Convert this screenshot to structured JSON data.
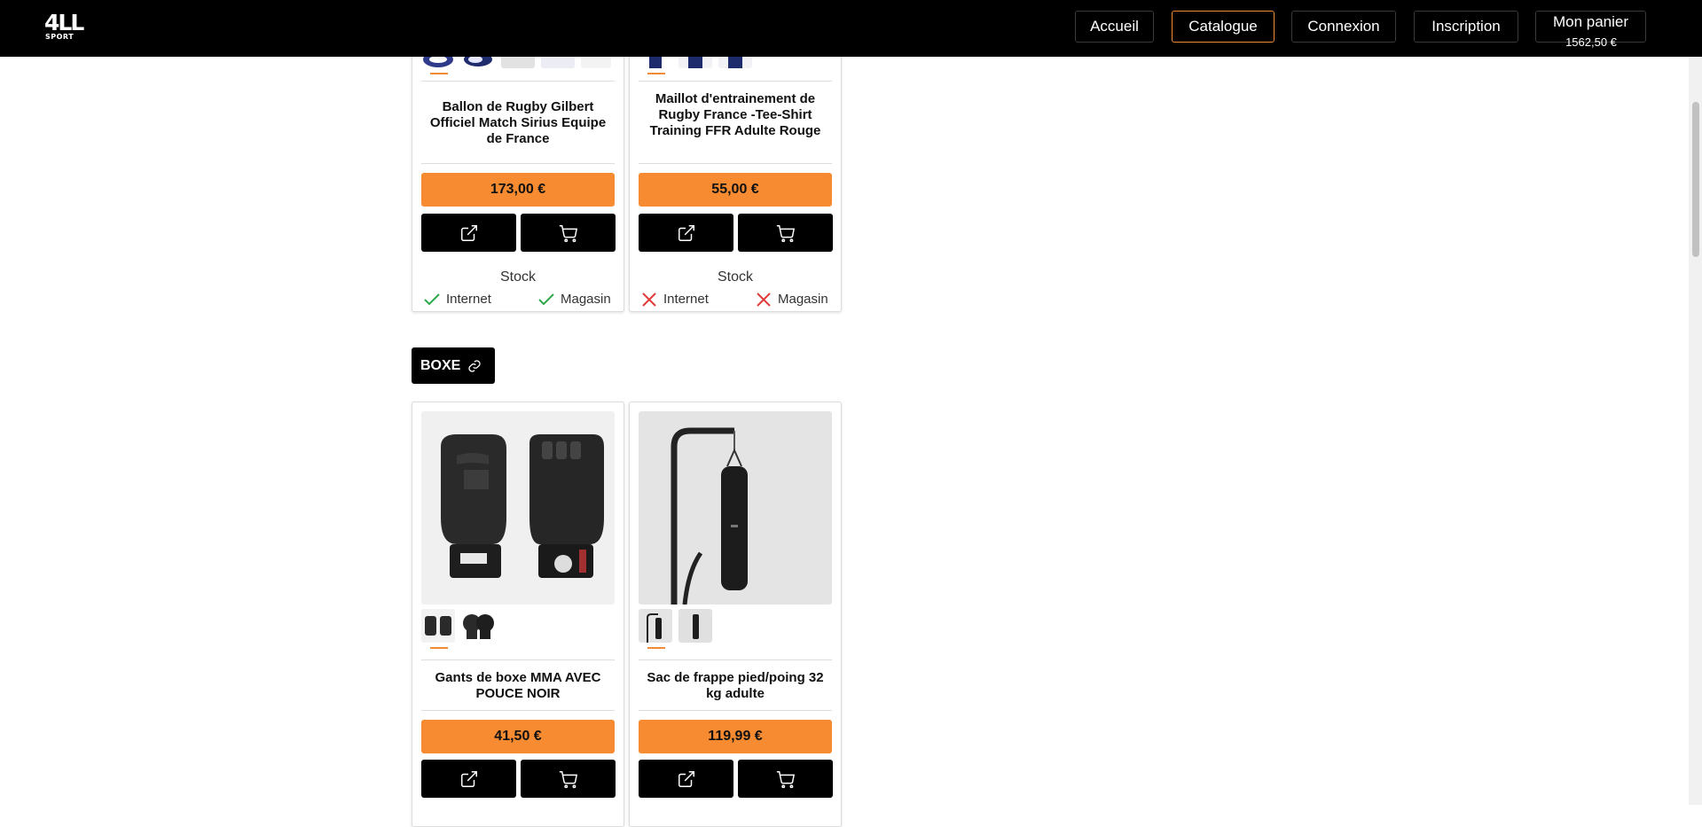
{
  "header": {
    "logo": {
      "top": "4LL",
      "bottom": "SPORT"
    },
    "nav": [
      {
        "label": "Accueil",
        "active": false
      },
      {
        "label": "Catalogue",
        "active": true
      },
      {
        "label": "Connexion",
        "active": false
      },
      {
        "label": "Inscription",
        "active": false
      },
      {
        "label": "Mon panier",
        "active": false
      }
    ],
    "cart_total": "1562,50 €"
  },
  "colors": {
    "accent": "#f68b32",
    "active_border": "#f08a35",
    "ok": "#2ea84a",
    "ko": "#e23b3b",
    "dark": "#000000"
  },
  "products_top": [
    {
      "title": "Ballon de Rugby Gilbert Officiel Match Sirius Equipe de France",
      "price": "173,00 €",
      "stock_label": "Stock",
      "internet": {
        "label": "Internet",
        "available": true
      },
      "store": {
        "label": "Magasin",
        "available": true
      }
    },
    {
      "title": "Maillot d'entrainement de Rugby France -Tee-Shirt Training FFR Adulte Rouge",
      "price": "55,00 €",
      "stock_label": "Stock",
      "internet": {
        "label": "Internet",
        "available": false
      },
      "store": {
        "label": "Magasin",
        "available": false
      }
    }
  ],
  "section": {
    "label": "BOXE",
    "icon": "link-icon"
  },
  "products_boxe": [
    {
      "title": "Gants de boxe MMA AVEC POUCE NOIR",
      "price": "41,50 €"
    },
    {
      "title": "Sac de frappe pied/poing 32 kg adulte",
      "price": "119,99 €"
    }
  ],
  "icons": {
    "open": "external-link-icon",
    "cart": "cart-icon",
    "ok": "check-icon",
    "ko": "cross-icon"
  }
}
